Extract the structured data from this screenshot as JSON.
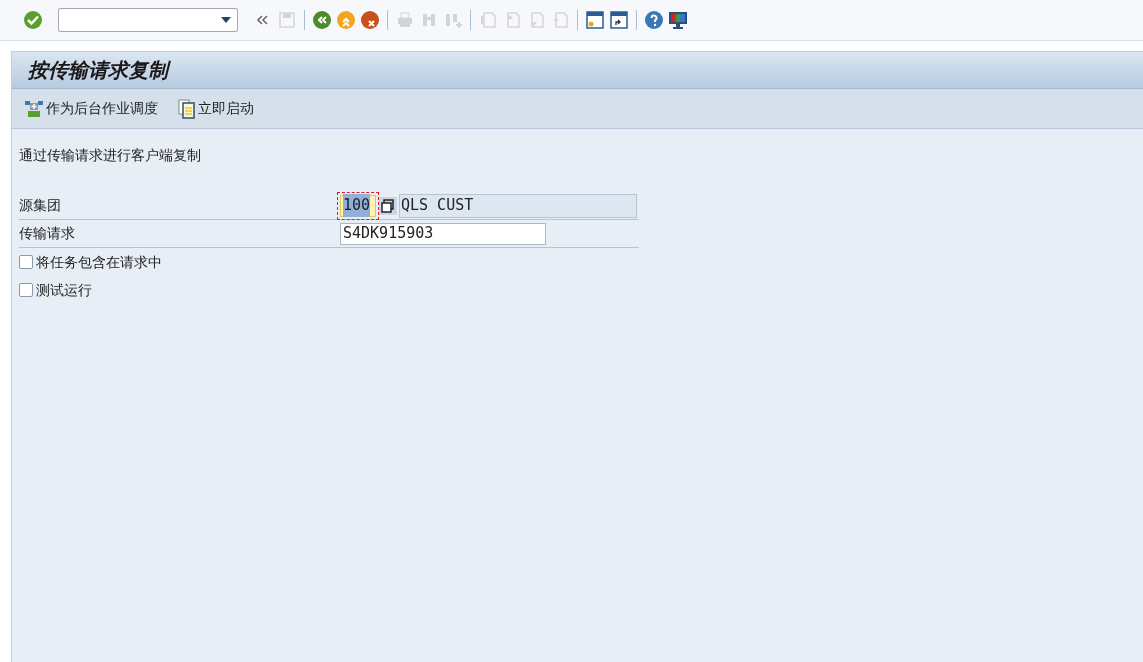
{
  "title": "按传输请求复制",
  "app_toolbar": [
    {
      "kind": "schedule",
      "label": "作为后台作业调度"
    },
    {
      "kind": "execute",
      "label": "立即启动"
    }
  ],
  "description": "通过传输请求进行客户端复制",
  "fields": [
    {
      "label": "源集团",
      "value": "100",
      "focused": true,
      "text": "QLS CUST"
    },
    {
      "label": "传输请求",
      "value": "S4DK915903",
      "focused": false
    }
  ],
  "checkboxes": [
    {
      "label": "将任务包含在请求中",
      "checked": false
    },
    {
      "label": "测试运行",
      "checked": false
    }
  ]
}
